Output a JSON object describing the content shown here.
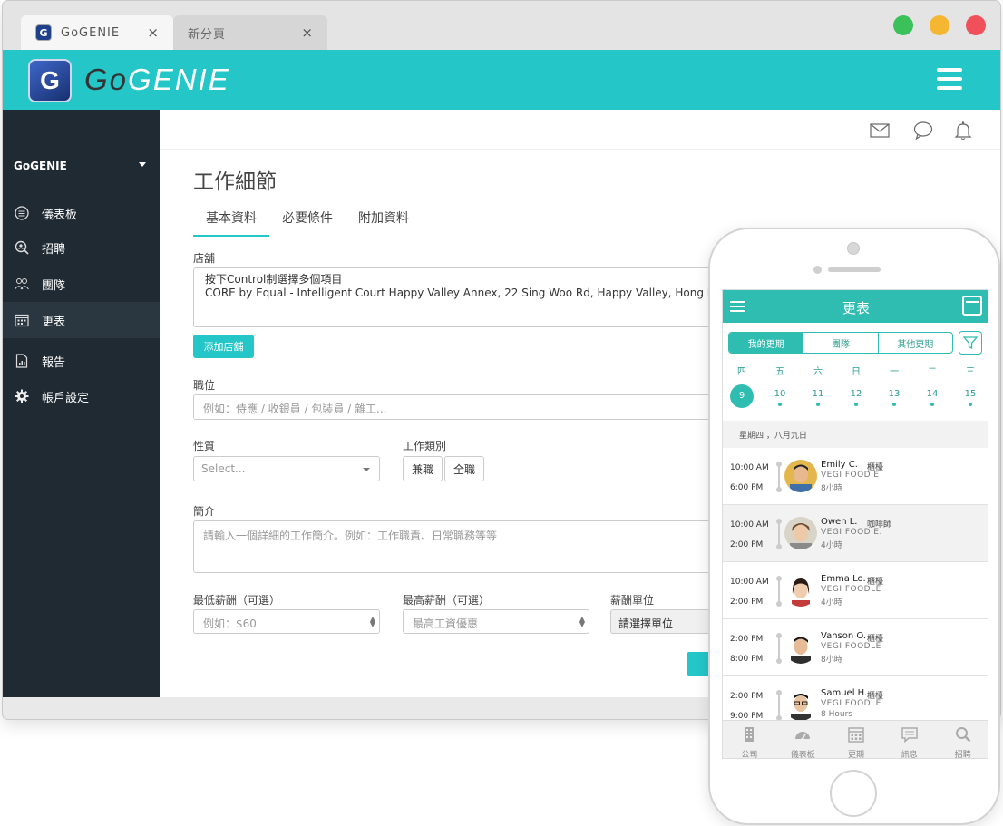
{
  "browser": {
    "tabs": [
      {
        "label": "GoGENIE",
        "close": "×"
      },
      {
        "label": "新分頁",
        "close": "×"
      }
    ],
    "traffic_lights": [
      "#3cc15a",
      "#f5b731",
      "#f0505a"
    ]
  },
  "header": {
    "logo_letter": "G",
    "logo_prefix": "Go",
    "logo_suffix": "GENIE",
    "color": "#24c6c8"
  },
  "sidebar": {
    "company": "GoGENIE",
    "items": [
      {
        "label": "儀表板",
        "icon": "dashboard-icon"
      },
      {
        "label": "招聘",
        "icon": "recruit-icon"
      },
      {
        "label": "團隊",
        "icon": "team-icon"
      },
      {
        "label": "更表",
        "icon": "calendar-icon"
      },
      {
        "label": "報告",
        "icon": "report-icon"
      },
      {
        "label": "帳戶設定",
        "icon": "gear-icon"
      }
    ]
  },
  "content": {
    "title": "工作細節",
    "tabs": [
      "基本資料",
      "必要條件",
      "附加資料"
    ],
    "store_label": "店舖",
    "store_lines": [
      "按下Control制選擇多個項目",
      "CORE by Equal - Intelligent Court Happy Valley Annex, 22 Sing Woo Rd, Happy Valley, Hong Kong, n/a, n/a, Hong"
    ],
    "add_store": "添加店舖",
    "position_label": "職位",
    "position_placeholder": "例如：侍應 / 收銀員 / 包裝員 / 雜工...",
    "nature_label": "性質",
    "nature_select": "Select...",
    "type_label": "工作類別",
    "type_options": [
      "兼職",
      "全職"
    ],
    "intro_label": "簡介",
    "intro_placeholder": "請輸入一個詳細的工作簡介。例如：工作職責、日常職務等等",
    "min_salary_label": "最低薪酬（可選）",
    "min_salary_placeholder": "例如：$60",
    "max_salary_label": "最高薪酬（可選）",
    "max_salary_placeholder": "最高工資優惠",
    "unit_label": "薪酬單位",
    "unit_select": "請選擇單位"
  },
  "mobile": {
    "title": "更表",
    "segments": [
      "我的更期",
      "團隊",
      "其他更期"
    ],
    "week": [
      {
        "d": "四",
        "n": "9"
      },
      {
        "d": "五",
        "n": "10"
      },
      {
        "d": "六",
        "n": "11"
      },
      {
        "d": "日",
        "n": "12"
      },
      {
        "d": "一",
        "n": "13"
      },
      {
        "d": "二",
        "n": "14"
      },
      {
        "d": "三",
        "n": "15"
      }
    ],
    "date_header": "星期四 ，八月九日",
    "shifts": [
      {
        "start": "10:00 AM",
        "end": "6:00 PM",
        "name": "Emily C.",
        "role": "櫃檯",
        "company": "VEGI FOODIE",
        "duration": "8小時"
      },
      {
        "start": "10:00 AM",
        "end": "2:00 PM",
        "name": "Owen L.",
        "role": "咖啡師",
        "company": "VEGI FOODIE.",
        "duration": "4小時"
      },
      {
        "start": "10:00 AM",
        "end": "2:00 PM",
        "name": "Emma Lo.",
        "role": "櫃檯",
        "company": "VEGI FOODLE",
        "duration": "4小時"
      },
      {
        "start": "2:00 PM",
        "end": "8:00 PM",
        "name": "Vanson O.",
        "role": "櫃檯",
        "company": "VEGI FOODLE",
        "duration": "8小時"
      },
      {
        "start": "2:00 PM",
        "end": "9:00 PM",
        "name": "Samuel H.",
        "role": "櫃檯",
        "company": "VEGI FOODLE",
        "duration": "8 Hours"
      }
    ],
    "tabbar": [
      "公司",
      "儀表板",
      "更期",
      "訊息",
      "招聘"
    ],
    "accent": "#2ebdb0"
  }
}
